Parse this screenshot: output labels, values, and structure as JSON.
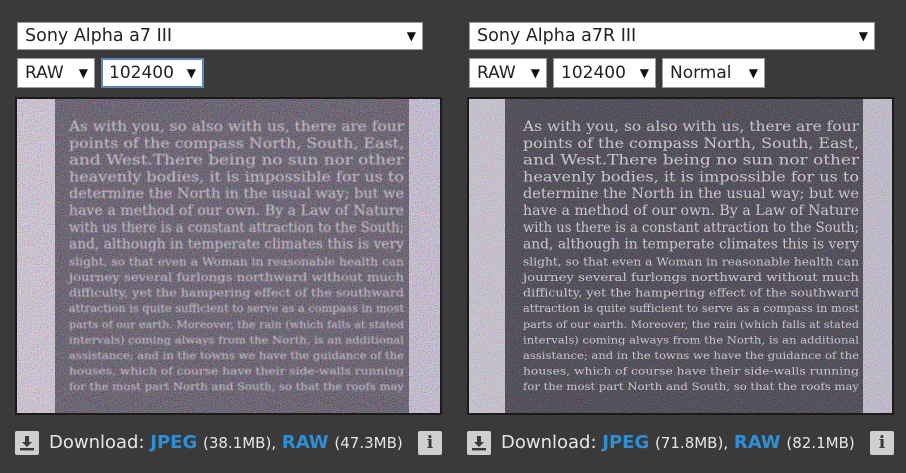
{
  "left": {
    "camera": "Sony Alpha a7 III",
    "format": "RAW",
    "iso": "102400",
    "download_label": "Download:",
    "jpeg_label": "JPEG",
    "jpeg_size": "(38.1MB),",
    "raw_label": "RAW",
    "raw_size": "(47.3MB)",
    "sample_text": [
      "As with you, so also with us, there are four",
      "points of the compass North, South, East,",
      "and West.There being no sun nor other",
      "heavenly bodies, it is impossible for us to",
      "determine the North in the usual way; but we",
      "have a method of our own. By a Law of Nature",
      "with us there is a constant attraction to the South;",
      "and, although in temperate climates this is very",
      "slight, so that even a Woman in reasonable health can",
      "journey several furlongs northward without much",
      "difficulty, yet the hampering effect of the southward",
      "attraction is quite sufficient to serve as a compass in most",
      "parts of our earth. Moreover, the rain (which falls at stated",
      "intervals) coming always from the North, is an additional",
      "assistance; and in the towns we have the guidance of the",
      "houses, which of course have their side-walls running",
      "for the most part North and South, so that the roofs may"
    ]
  },
  "right": {
    "camera": "Sony Alpha a7R III",
    "format": "RAW",
    "iso": "102400",
    "mode": "Normal",
    "download_label": "Download:",
    "jpeg_label": "JPEG",
    "jpeg_size": "(71.8MB),",
    "raw_label": "RAW",
    "raw_size": "(82.1MB)",
    "sample_text": [
      "As with you, so also with us, there are four",
      "points of the compass North, South, East,",
      "and West.There being no sun nor other",
      "heavenly bodies, it is impossible for us to",
      "determine the North in the usual way; but we",
      "have a method of our own. By a Law of Nature",
      "with us there is a constant attraction to the South;",
      "and, although in temperate climates this is very",
      "slight, so that even a Woman in reasonable health can",
      "journey several furlongs northward without much",
      "difficulty, yet the hampering effect of the southward",
      "attraction is quite sufficient to serve as a compass in most",
      "parts of our earth. Moreover, the rain (which falls at stated",
      "intervals) coming always from the North, is an additional",
      "assistance; and in the towns we have the guidance of the",
      "houses, which of course have their side-walls running",
      "for the most part North and South, so that the roofs may"
    ]
  },
  "colors": {
    "background": "#3a3a3a",
    "link": "#2e8fd6",
    "text": "#e6e6e6"
  }
}
